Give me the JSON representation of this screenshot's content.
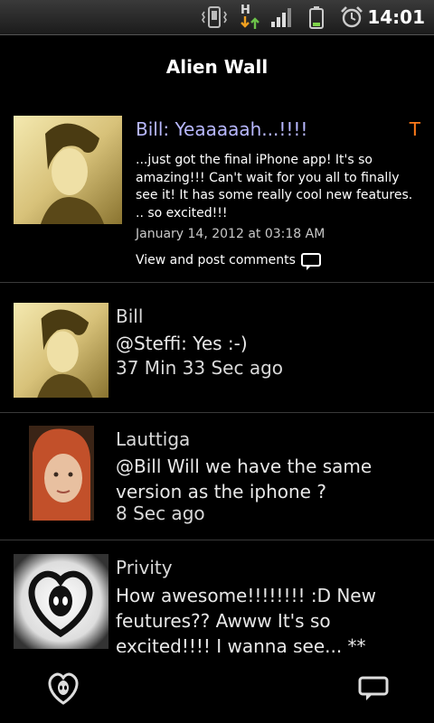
{
  "status_bar": {
    "time": "14:01",
    "network_label": "H",
    "icons": [
      "vibrate-icon",
      "network-h-icon",
      "signal-icon",
      "battery-icon",
      "alarm-icon"
    ]
  },
  "app": {
    "title": "Alien Wall"
  },
  "post": {
    "title": "Bill: Yeaaaaah...!!!!",
    "badge": "T",
    "body": "...just got the final iPhone app! It's so amazing!!! Can't wait for you all to finally see it! It has some really cool new features. .. so excited!!!",
    "date": "January 14, 2012 at 03:18 AM",
    "comments_link": "View and post comments"
  },
  "comments": [
    {
      "name": "Bill",
      "text": "@Steffi: Yes :-)",
      "time": "37 Min 33 Sec ago"
    },
    {
      "name": "Lauttiga",
      "text": "@Bill Will we have the same version as the iphone ?",
      "time": "8 Sec ago"
    },
    {
      "name": "Privity",
      "text": "How awesome!!!!!!!! :D New feutures?? Awww It's so excited!!!! I wanna see... **",
      "time": ""
    }
  ],
  "colors": {
    "post_title": "#b8b8ff",
    "badge": "#ff7a1a",
    "background": "#000000"
  },
  "bottom_bar": {
    "left_icon": "alien-heart-icon",
    "right_icon": "chat-bubble-icon"
  }
}
